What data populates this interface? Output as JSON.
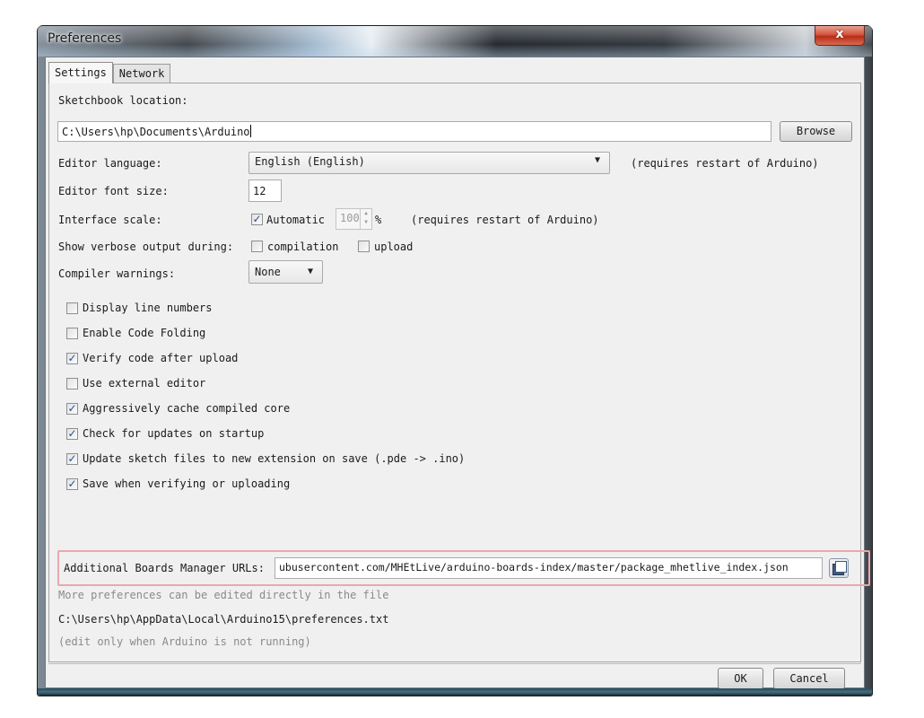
{
  "window": {
    "title": "Preferences",
    "close_label": "x"
  },
  "tabs": [
    {
      "label": "Settings",
      "active": true
    },
    {
      "label": "Network",
      "active": false
    }
  ],
  "sketchbook": {
    "label": "Sketchbook location:",
    "value": "C:\\Users\\hp\\Documents\\Arduino",
    "browse_label": "Browse"
  },
  "editor_language": {
    "label": "Editor language:",
    "value": "English (English)",
    "note": "(requires restart of Arduino)"
  },
  "editor_font_size": {
    "label": "Editor font size:",
    "value": "12"
  },
  "interface_scale": {
    "label": "Interface scale:",
    "automatic_label": "Automatic",
    "automatic_checked": true,
    "value": "100",
    "unit": "%",
    "note": "(requires restart of Arduino)"
  },
  "verbose": {
    "label": "Show verbose output during:",
    "compilation_label": "compilation",
    "compilation_checked": false,
    "upload_label": "upload",
    "upload_checked": false
  },
  "compiler_warnings": {
    "label": "Compiler warnings:",
    "value": "None"
  },
  "options": [
    {
      "label": "Display line numbers",
      "checked": false
    },
    {
      "label": "Enable Code Folding",
      "checked": false
    },
    {
      "label": "Verify code after upload",
      "checked": true
    },
    {
      "label": "Use external editor",
      "checked": false
    },
    {
      "label": "Aggressively cache compiled core",
      "checked": true
    },
    {
      "label": "Check for updates on startup",
      "checked": true
    },
    {
      "label": "Update sketch files to new extension on save (.pde -> .ino)",
      "checked": true
    },
    {
      "label": "Save when verifying or uploading",
      "checked": true
    }
  ],
  "boards_manager": {
    "label": "Additional Boards Manager URLs:",
    "value": "ubusercontent.com/MHEtLive/arduino-boards-index/master/package_mhetlive_index.json",
    "highlight_color": "#e8a8ae"
  },
  "footer_info": {
    "more_prefs": "More preferences can be edited directly in the file",
    "prefs_path": "C:\\Users\\hp\\AppData\\Local\\Arduino15\\preferences.txt",
    "edit_note": "(edit only when Arduino is not running)"
  },
  "buttons": {
    "ok_label": "OK",
    "cancel_label": "Cancel"
  }
}
